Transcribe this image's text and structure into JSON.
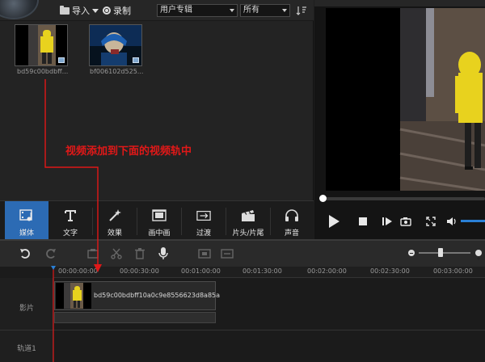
{
  "library": {
    "import_label": "导入",
    "record_label": "录制",
    "album_select": "用户专辑",
    "filter_select": "所有",
    "items": [
      {
        "name": "bd59c00bdbff..."
      },
      {
        "name": "bf006102d525..."
      }
    ]
  },
  "annotation": {
    "text": "视频添加到下面的视频轨中"
  },
  "categories": [
    {
      "label": "媒体",
      "icon": "film-music-icon",
      "active": true
    },
    {
      "label": "文字",
      "icon": "text-t-icon"
    },
    {
      "label": "效果",
      "icon": "magic-wand-icon"
    },
    {
      "label": "画中画",
      "icon": "picture-in-picture-icon"
    },
    {
      "label": "过渡",
      "icon": "transition-icon"
    },
    {
      "label": "片头/片尾",
      "icon": "clapper-icon"
    },
    {
      "label": "声音",
      "icon": "headphones-icon"
    }
  ],
  "timeline": {
    "ruler": [
      "00:00:00:00",
      "00:00:30:00",
      "00:01:00:00",
      "00:01:30:00",
      "00:02:00:00",
      "00:02:30:00",
      "00:03:00:00"
    ],
    "tracks": {
      "video_label": "影片",
      "track1_label": "轨道1"
    },
    "clip_name": "bd59c00bdbff10a0c9e8556623d8a85a"
  },
  "colors": {
    "accent": "#2c6bb4",
    "annotation": "#e01818"
  }
}
